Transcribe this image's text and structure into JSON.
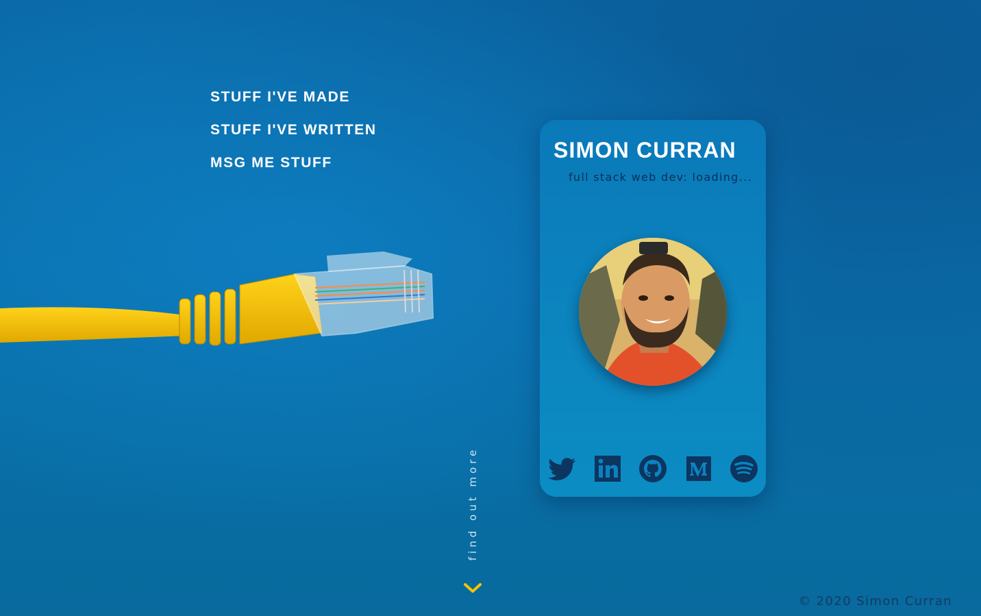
{
  "nav": {
    "items": [
      {
        "label": "STUFF I'VE MADE"
      },
      {
        "label": "STUFF I'VE WRITTEN"
      },
      {
        "label": "MSG ME STUFF"
      }
    ]
  },
  "card": {
    "name": "SIMON CURRAN",
    "subtitle": "full stack web dev: loading...",
    "socials": [
      {
        "icon": "twitter-icon"
      },
      {
        "icon": "linkedin-icon"
      },
      {
        "icon": "github-icon"
      },
      {
        "icon": "medium-icon"
      },
      {
        "icon": "spotify-icon"
      }
    ]
  },
  "scroll": {
    "label": "find out more"
  },
  "footer": {
    "copyright": "© 2020 Simon Curran"
  },
  "colors": {
    "background": "#0a72ad",
    "card": "#0a7fbc",
    "icon": "#0c3560",
    "accent": "#f5c400"
  }
}
